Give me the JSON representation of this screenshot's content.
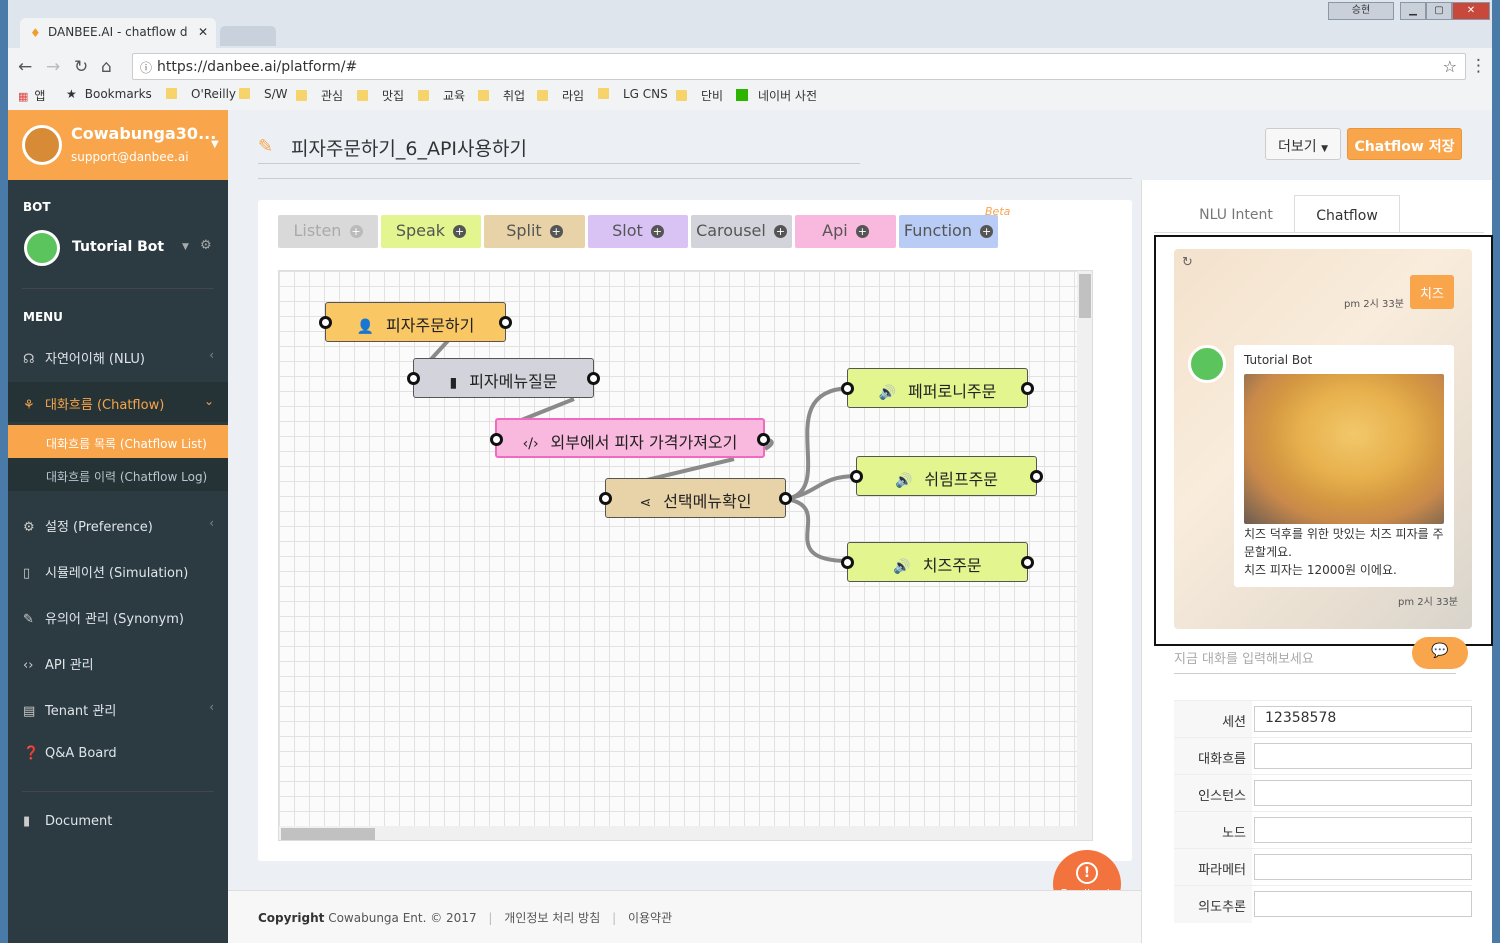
{
  "browser": {
    "tab_title": "DANBEE.AI - chatflow d",
    "url": "https://danbee.ai/platform/#",
    "user_label": "승현",
    "bookmarks": [
      "앱",
      "Bookmarks",
      "O'Reilly",
      "S/W",
      "관심",
      "맛집",
      "교육",
      "취업",
      "라임",
      "LG CNS",
      "단비",
      "네이버 사전"
    ]
  },
  "sidebar": {
    "profile_name": "Cowabunga30...",
    "profile_email": "support@danbee.ai",
    "bot_header": "BOT",
    "bot_name": "Tutorial Bot",
    "menu_header": "MENU",
    "menu": [
      {
        "label": "자연어이해 (NLU)",
        "icon": "headset-icon"
      },
      {
        "label": "대화흐름 (Chatflow)",
        "icon": "flow-icon"
      },
      {
        "label": "설정 (Preference)",
        "icon": "gears-icon"
      },
      {
        "label": "시뮬레이션 (Simulation)",
        "icon": "mobile-icon"
      },
      {
        "label": "유의어 관리 (Synonym)",
        "icon": "edit-icon"
      },
      {
        "label": "API 관리",
        "icon": "code-icon"
      },
      {
        "label": "Tenant 관리",
        "icon": "building-icon"
      },
      {
        "label": "Q&A Board",
        "icon": "question-icon"
      },
      {
        "label": "Document",
        "icon": "book-icon"
      }
    ],
    "submenu": [
      "대화흐름 목록 (Chatflow List)",
      "대화흐름 이력 (Chatflow Log)"
    ]
  },
  "main": {
    "title": "피자주문하기_6_API사용하기",
    "more_label": "더보기",
    "save_label": "Chatflow 저장",
    "palette": [
      {
        "label": "Listen",
        "color": "#d9d9d9",
        "text_color": "#aaaaaa"
      },
      {
        "label": "Speak",
        "color": "#e2f58f",
        "text_color": "#444444"
      },
      {
        "label": "Split",
        "color": "#e8d3a8",
        "text_color": "#444444"
      },
      {
        "label": "Slot",
        "color": "#d9c3f5",
        "text_color": "#444444"
      },
      {
        "label": "Carousel",
        "color": "#d3d3dc",
        "text_color": "#444444"
      },
      {
        "label": "Api",
        "color": "#f9b8dd",
        "text_color": "#444444"
      },
      {
        "label": "Function",
        "color": "#b8ccf5",
        "text_color": "#444444"
      }
    ],
    "beta_label": "Beta",
    "nodes": [
      {
        "label": "피자주문하기",
        "icon": "listen-icon",
        "color": "#f9c864"
      },
      {
        "label": "피자메뉴질문",
        "icon": "carousel-icon",
        "color": "#d3d3dc"
      },
      {
        "label": "외부에서 피자 가격가져오기",
        "icon": "code-icon",
        "color": "#f9b8dd"
      },
      {
        "label": "선택메뉴확인",
        "icon": "share-icon",
        "color": "#e8d3a8"
      },
      {
        "label": "페퍼로니주문",
        "icon": "speak-icon",
        "color": "#e2f58f"
      },
      {
        "label": "쉬림프주문",
        "icon": "speak-icon",
        "color": "#e2f58f"
      },
      {
        "label": "치즈주문",
        "icon": "speak-icon",
        "color": "#e2f58f"
      }
    ],
    "feedback_label": "Feedback"
  },
  "footer": {
    "copyright_bold": "Copyright",
    "copyright_rest": "Cowabunga Ent. © 2017",
    "privacy": "개인정보 처리 방침",
    "terms": "이용약관"
  },
  "right_panel": {
    "tab_nlu": "NLU Intent",
    "tab_chatflow": "Chatflow",
    "user_message": "치즈",
    "user_time": "pm 2시 33분",
    "bot_name": "Tutorial Bot",
    "bot_message_1": "치즈 덕후를 위한 맛있는 치즈 피자를 주문할게요.",
    "bot_message_2": "치즈 피자는 12000원 이에요.",
    "bot_time": "pm 2시 33분",
    "input_placeholder": "지금 대화를 입력해보세요",
    "fields": [
      {
        "label": "세션",
        "value": "12358578"
      },
      {
        "label": "대화흐름",
        "value": ""
      },
      {
        "label": "인스턴스",
        "value": ""
      },
      {
        "label": "노드",
        "value": ""
      },
      {
        "label": "파라메터",
        "value": ""
      },
      {
        "label": "의도추론",
        "value": ""
      }
    ]
  }
}
